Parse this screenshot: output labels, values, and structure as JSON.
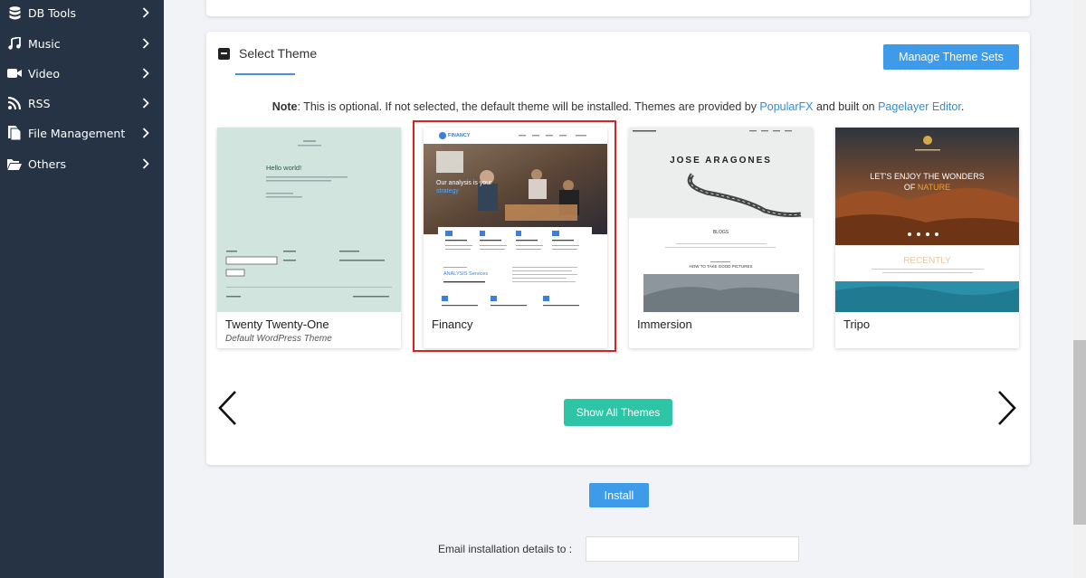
{
  "sidebar": {
    "items": [
      {
        "label": "DB Tools",
        "icon": "database-icon"
      },
      {
        "label": "Music",
        "icon": "music-note-icon"
      },
      {
        "label": "Video",
        "icon": "video-camera-icon"
      },
      {
        "label": "RSS",
        "icon": "rss-icon"
      },
      {
        "label": "File Management",
        "icon": "file-icon"
      },
      {
        "label": "Others",
        "icon": "folder-open-icon"
      }
    ]
  },
  "theme_section": {
    "title": "Select Theme",
    "manage_button": "Manage Theme Sets",
    "note": {
      "label": "Note",
      "text1": ": This is optional. If not selected, the default theme will be installed. Themes are provided by ",
      "link1": "PopularFX",
      "text2": " and built on ",
      "link2": "Pagelayer Editor",
      "text3": "."
    },
    "themes": [
      {
        "name": "Twenty Twenty-One",
        "subtitle": "Default WordPress Theme",
        "selected": false
      },
      {
        "name": "Financy",
        "subtitle": "",
        "selected": true
      },
      {
        "name": "Immersion",
        "subtitle": "",
        "selected": false
      },
      {
        "name": "Tripo",
        "subtitle": "",
        "selected": false
      }
    ],
    "preview_text": {
      "tt1_hello": "Hello world!",
      "financy_logo": "FINANCY",
      "financy_hero": "Our analysis is your",
      "financy_hero2": "strategy",
      "financy_services": "ANALYSIS Services",
      "immersion_title": "JOSE ARAGONES",
      "immersion_blogs": "BLOGS",
      "immersion_caption": "HOW TO TAKE GOOD PICTURES",
      "tripo_heading": "LET'S ENJOY THE WONDERS",
      "tripo_heading2a": "OF ",
      "tripo_heading2b": "NATURE",
      "tripo_recently": "RECENTLY"
    },
    "show_all_button": "Show All Themes"
  },
  "install_button": "Install",
  "email": {
    "label": "Email installation details to :",
    "value": "",
    "placeholder": ""
  },
  "colors": {
    "sidebar_bg": "#253344",
    "primary": "#3d9be9",
    "teal": "#2ec4a6",
    "selected_border": "#e02020"
  }
}
